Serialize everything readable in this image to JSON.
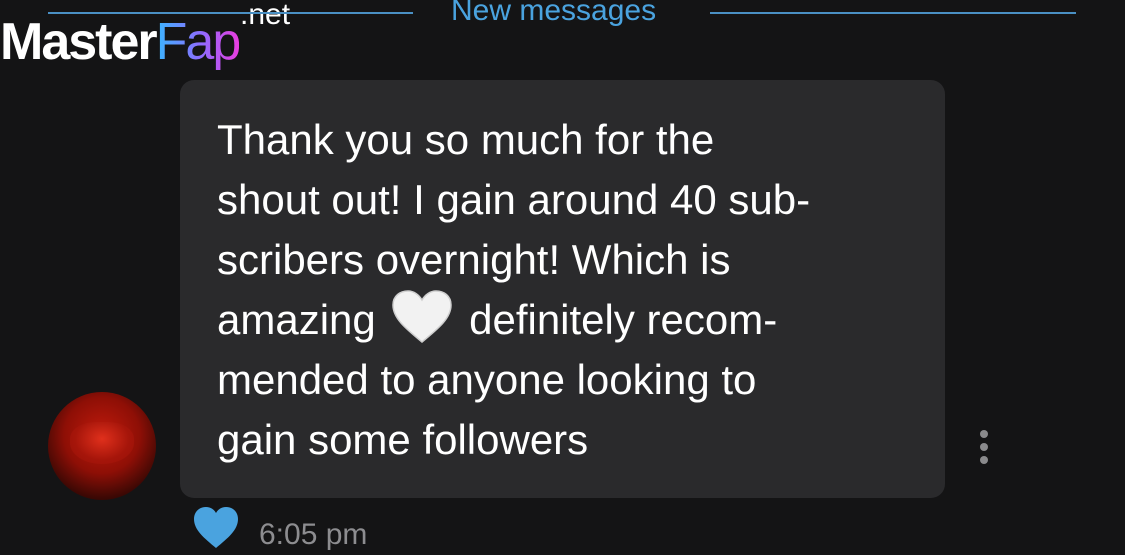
{
  "watermark": {
    "brand_main": "Master",
    "brand_accent": "Fap",
    "brand_tld": ".net"
  },
  "divider": {
    "label": "New messages",
    "color": "#4aa3df"
  },
  "message": {
    "lines": [
      "Thank you so much for the",
      "shout out! I gain around 40 sub-",
      "scribers overnight! Which is",
      "amazing",
      "definitely recom-",
      "mended to anyone looking to",
      "gain some followers"
    ],
    "emoji": "white-heart-icon",
    "timestamp": "6:05 pm",
    "liked": true
  },
  "colors": {
    "background": "#141415",
    "bubble": "#2a2a2c",
    "text": "#ffffff",
    "like": "#4aa3df",
    "timestamp": "#8d8d90"
  }
}
